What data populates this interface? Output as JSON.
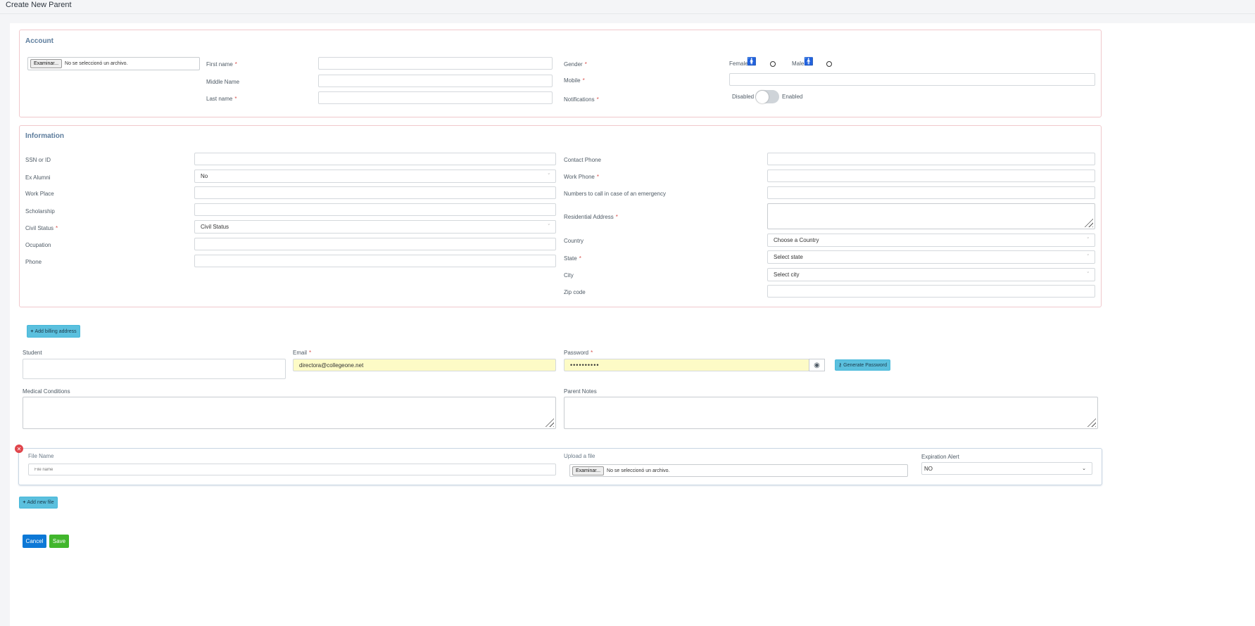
{
  "page": {
    "title": "Create New Parent"
  },
  "account": {
    "title": "Account",
    "photo": {
      "button": "Examinar...",
      "status": "No se seleccionó un archivo."
    },
    "first_name": {
      "label": "First name",
      "value": ""
    },
    "middle_name": {
      "label": "Middle Name",
      "value": ""
    },
    "last_name": {
      "label": "Last name",
      "value": ""
    },
    "gender": {
      "label": "Gender",
      "female": "Female",
      "male": "Male"
    },
    "mobile": {
      "label": "Mobile",
      "value": ""
    },
    "notifications": {
      "label": "Notifications",
      "off": "Disabled",
      "on": "Enabled",
      "enabled": false
    }
  },
  "information": {
    "title": "Information",
    "ssn": {
      "label": "SSN or ID",
      "value": ""
    },
    "ex_alumni": {
      "label": "Ex Alumni",
      "value": "No"
    },
    "work_place": {
      "label": "Work Place",
      "value": ""
    },
    "scholarship": {
      "label": "Scholarship",
      "value": ""
    },
    "civil_status": {
      "label": "Civil Status",
      "value": "Civil Status"
    },
    "ocupation": {
      "label": "Ocupation",
      "value": ""
    },
    "phone": {
      "label": "Phone",
      "value": ""
    },
    "contact_phone": {
      "label": "Contact Phone",
      "value": ""
    },
    "work_phone": {
      "label": "Work Phone",
      "value": ""
    },
    "emergency": {
      "label": "Numbers to call in case of an emergency",
      "value": ""
    },
    "address": {
      "label": "Residential Address",
      "value": ""
    },
    "country": {
      "label": "Country",
      "value": "Choose a Country"
    },
    "state": {
      "label": "State",
      "value": "Select state"
    },
    "city": {
      "label": "City",
      "value": "Select city"
    },
    "zip": {
      "label": "Zip code",
      "value": ""
    }
  },
  "billing": {
    "button": "Add billing address",
    "icon": "plus-icon"
  },
  "login": {
    "student": {
      "label": "Student",
      "value": ""
    },
    "email": {
      "label": "Email",
      "value": "directora@collegeone.net"
    },
    "password": {
      "label": "Password",
      "value": "••••••••••",
      "eye_icon": "eye-icon"
    },
    "generate": {
      "label": "Generate Password",
      "icon": "key-icon"
    }
  },
  "notes": {
    "medical": {
      "label": "Medical Conditions",
      "value": ""
    },
    "parent": {
      "label": "Parent Notes",
      "value": ""
    }
  },
  "files": {
    "file_name": {
      "label": "File Name",
      "placeholder": "File name"
    },
    "upload": {
      "label": "Upload a file",
      "button": "Examinar...",
      "status": "No se seleccionó un archivo."
    },
    "expiration": {
      "label": "Expiration Alert",
      "value": "NO"
    },
    "remove_icon": "close-icon",
    "add_button": "Add new file"
  },
  "actions": {
    "cancel": "Cancel",
    "save": "Save"
  },
  "colors": {
    "required": "#d9534f",
    "info": "#5bc0de",
    "primary": "#0d78d6",
    "success": "#41b62c",
    "autofill": "#fdfbc6",
    "panel_border": "#f0c8cc"
  }
}
